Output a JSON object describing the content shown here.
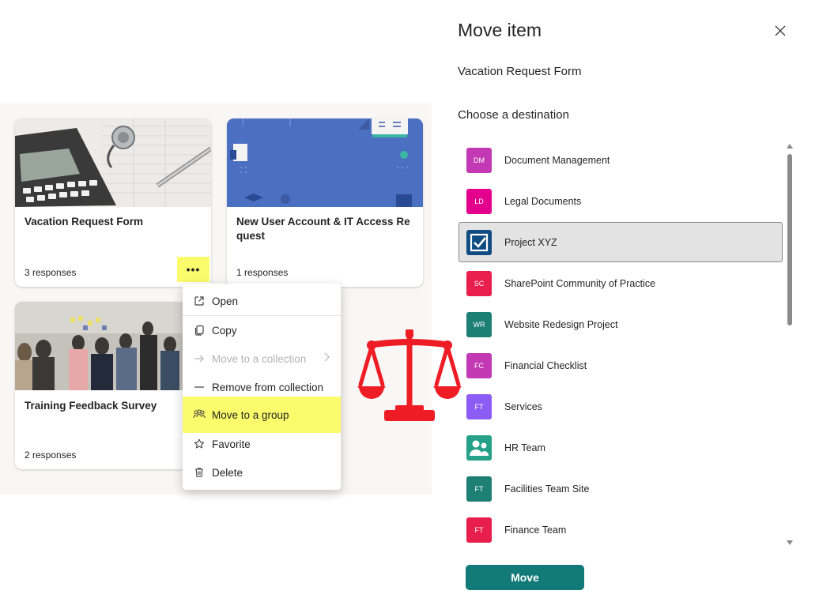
{
  "forms": {
    "cards": [
      {
        "title": "Vacation Request Form",
        "responses": "3 responses",
        "more_label": "•••"
      },
      {
        "title": "New User Account & IT Access Request",
        "responses": "1 responses"
      },
      {
        "title": "Training Feedback Survey",
        "responses": "2 responses"
      }
    ]
  },
  "context_menu": {
    "items": [
      {
        "label": "Open",
        "icon": "open-external-icon"
      },
      {
        "label": "Copy",
        "icon": "copy-icon"
      },
      {
        "label": "Move to a collection",
        "icon": "arrow-right-icon",
        "disabled": true
      },
      {
        "label": "Remove from collection",
        "icon": "minus-icon"
      },
      {
        "label": "Move to a group",
        "icon": "people-group-icon",
        "highlighted": true
      },
      {
        "label": "Favorite",
        "icon": "star-icon"
      },
      {
        "label": "Delete",
        "icon": "trash-icon"
      }
    ]
  },
  "panel": {
    "title": "Move item",
    "item_name": "Vacation Request Form",
    "destination_label": "Choose a destination",
    "move_button": "Move",
    "destinations": [
      {
        "initials": "DM",
        "label": "Document Management",
        "color": "#c239b3"
      },
      {
        "initials": "LD",
        "label": "Legal Documents",
        "color": "#e3008c"
      },
      {
        "initials": "",
        "label": "Project XYZ",
        "color": "#0f4c81",
        "icon": "checkbox-icon",
        "selected": true
      },
      {
        "initials": "SC",
        "label": "SharePoint Community of Practice",
        "color": "#e81e4d"
      },
      {
        "initials": "WR",
        "label": "Website Redesign Project",
        "color": "#1e7f75"
      },
      {
        "initials": "FC",
        "label": "Financial Checklist",
        "color": "#c239b3"
      },
      {
        "initials": "FT",
        "label": "Services",
        "color": "#8c5cf5"
      },
      {
        "initials": "",
        "label": "HR Team",
        "color": "#25a189",
        "icon": "people-icon"
      },
      {
        "initials": "FT",
        "label": "Facilities Team Site",
        "color": "#1e7f75"
      },
      {
        "initials": "FT",
        "label": "Finance Team",
        "color": "#e81e4d"
      }
    ]
  },
  "colors": {
    "highlight": "#fbfb6b",
    "accent": "#127a78",
    "scale_icon": "#ee1c24"
  }
}
